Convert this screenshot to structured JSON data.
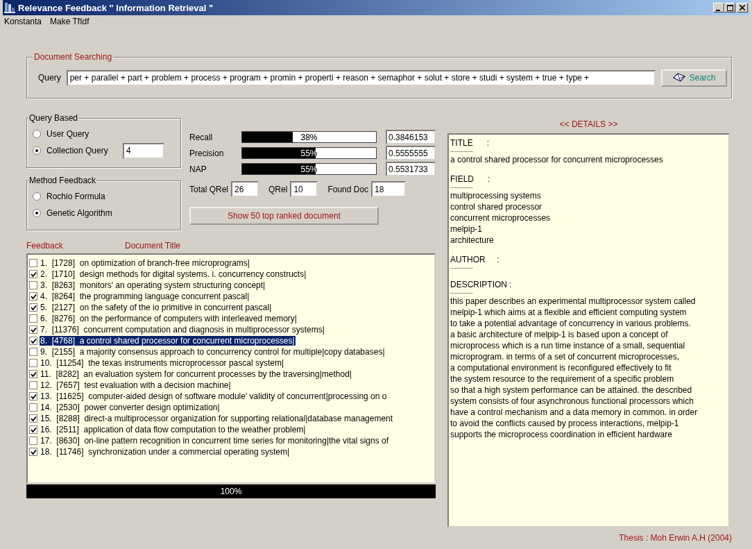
{
  "window": {
    "title": "Relevance Feedback \" Information Retrieval \""
  },
  "menu": [
    {
      "label": "Konstanta"
    },
    {
      "label": "Make TfIdf"
    }
  ],
  "document_searching": {
    "legend": "Document Searching",
    "query_label": "Query",
    "query_value": "per + parallel + part + problem + process + program + promin + properti + reason + semaphor + solut + store + studi + system + true + type +",
    "search_button": "Search"
  },
  "query_based": {
    "legend": "Query Based",
    "options": [
      {
        "label": "User Query",
        "selected": false
      },
      {
        "label": "Collection Query",
        "selected": true
      }
    ],
    "collection_value": "4"
  },
  "method_feedback": {
    "legend": "Method Feedback",
    "options": [
      {
        "label": "Rochio Formula",
        "selected": false
      },
      {
        "label": "Genetic Algorithm",
        "selected": true
      }
    ]
  },
  "metrics": [
    {
      "label": "Recall",
      "level": 0.38,
      "percent": "38%",
      "value": "0.3846153"
    },
    {
      "label": "Precision",
      "level": 0.55,
      "percent": "55%",
      "value": "0.5555555"
    },
    {
      "label": "NAP",
      "level": 0.55,
      "percent": "55%",
      "value": "0.5531733"
    }
  ],
  "counts": [
    {
      "label": "Total  QRel",
      "value": "26"
    },
    {
      "label": "QRel",
      "value": "10"
    },
    {
      "label": "Found Doc",
      "value": "18"
    }
  ],
  "show_button": "Show 50 top ranked document",
  "feedback_list": {
    "headers": [
      "Feedback",
      "Document Title"
    ],
    "rows": [
      {
        "label": "1.  [1728]  on optimization of branch-free microprograms|",
        "checked": false,
        "selected": false
      },
      {
        "label": "2.  [1710]  design methods for digital systems. i. concurrency constructs|",
        "checked": true,
        "selected": false
      },
      {
        "label": "3.  [8263]  monitors' an operating system structuring concept|",
        "checked": false,
        "selected": false
      },
      {
        "label": "4.  [8264]  the programming language concurrent pascal|",
        "checked": true,
        "selected": false
      },
      {
        "label": "5.  [2127]  on the safety of the io primitive in concurrent pascal|",
        "checked": true,
        "selected": false
      },
      {
        "label": "6.  [8276]  on the performance of computers with interleaved memory|",
        "checked": false,
        "selected": false
      },
      {
        "label": "7.  [11376]  concurrent computation and diagnosis in multiprocessor systems|",
        "checked": true,
        "selected": false
      },
      {
        "label": "8.  [4768]  a control shared processor for concurrent microprocesses|",
        "checked": true,
        "selected": true
      },
      {
        "label": "9.  [2155]  a majority consensus approach to concurrency control for multiple|copy databases|",
        "checked": false,
        "selected": false
      },
      {
        "label": "10.  [11254]  the texas instruments microprocessor pascal system|",
        "checked": false,
        "selected": false
      },
      {
        "label": "11.  [8282]  an evaluation system for concurrent processes by the traversing|method|",
        "checked": true,
        "selected": false
      },
      {
        "label": "12.  [7657]  test evaluation with a decision machine|",
        "checked": false,
        "selected": false
      },
      {
        "label": "13.  [11625]  computer-aided design of software module' validity of concurrent|processing on o",
        "checked": true,
        "selected": false
      },
      {
        "label": "14.  [2530]  power converter design optimization|",
        "checked": false,
        "selected": false
      },
      {
        "label": "15.  [8288]  direct-a multiprocessor organization for supporting relational|database management",
        "checked": true,
        "selected": false
      },
      {
        "label": "16.  [2511]  application of data flow computation to the weather problem|",
        "checked": true,
        "selected": false
      },
      {
        "label": "17.  [8630]  on-line pattern recognition in concurrent time series for monitoring|the vital signs of",
        "checked": false,
        "selected": false
      },
      {
        "label": "18.  [11746]  synchronization under a commercial operating system|",
        "checked": true,
        "selected": false
      }
    ]
  },
  "progress": {
    "level": 1,
    "text": "100%"
  },
  "details": {
    "heading": "<<  DETAILS  >>",
    "sections": [
      {
        "heading": "TITLE      :",
        "rule": "--------------",
        "lines": [
          "a control shared processor for concurrent microprocesses"
        ]
      },
      {
        "heading": "FIELD      :",
        "rule": "--------------",
        "lines": [
          "multiprocessing systems",
          "control shared processor",
          "concurrent microprocesses",
          "melpip-1",
          "architecture"
        ]
      },
      {
        "heading": "AUTHOR     :",
        "rule": "--------------"
      },
      {
        "heading": "DESCRIPTION :",
        "rule": "--------------",
        "lines": [
          "this paper describes an experimental multiprocessor system called",
          "melpip-1 which aims at a flexible and efficient computing system",
          "to take a potential advantage of concurrency in various problems.",
          "a basic architecture of melpip-1 is based upon a concept of",
          "microprocess which is a run time instance of a small, sequential",
          "microprogram. in terms of a set of concurrent microprocesses,",
          "a computational environment is reconfigured effectively to fit",
          "the system resource to the requirement of a specific problem",
          "so that a high system performance can be attained. the described",
          "system consists of four asynchronous functional processors which",
          "have a control mechanism and a data memory in common. in order",
          "to avoid the conflicts caused by process interactions, melpip-1",
          "supports the microprocess coordination in efficient hardware"
        ]
      }
    ]
  },
  "footer": "Thesis : Moh Erwin A.H  (2004)"
}
